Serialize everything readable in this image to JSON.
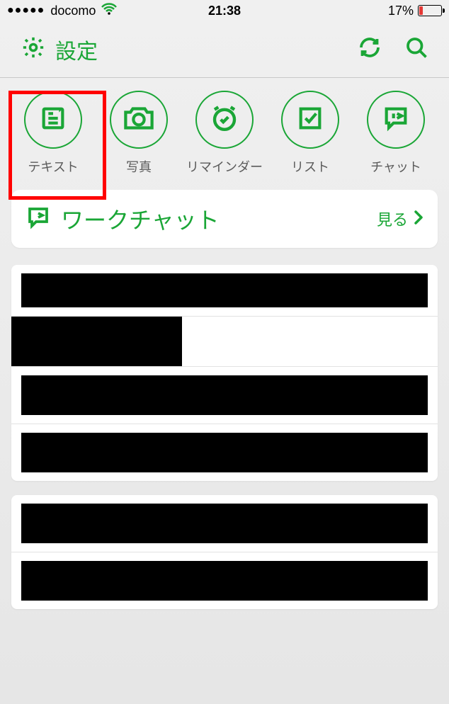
{
  "status": {
    "carrier": "docomo",
    "time": "21:38",
    "battery_pct": "17%"
  },
  "nav": {
    "title": "設定"
  },
  "actions": [
    {
      "label": "テキスト",
      "icon": "text"
    },
    {
      "label": "写真",
      "icon": "camera"
    },
    {
      "label": "リマインダー",
      "icon": "reminder"
    },
    {
      "label": "リスト",
      "icon": "checkbox"
    },
    {
      "label": "チャット",
      "icon": "chat"
    }
  ],
  "workchat": {
    "title": "ワークチャット",
    "see": "見る"
  }
}
